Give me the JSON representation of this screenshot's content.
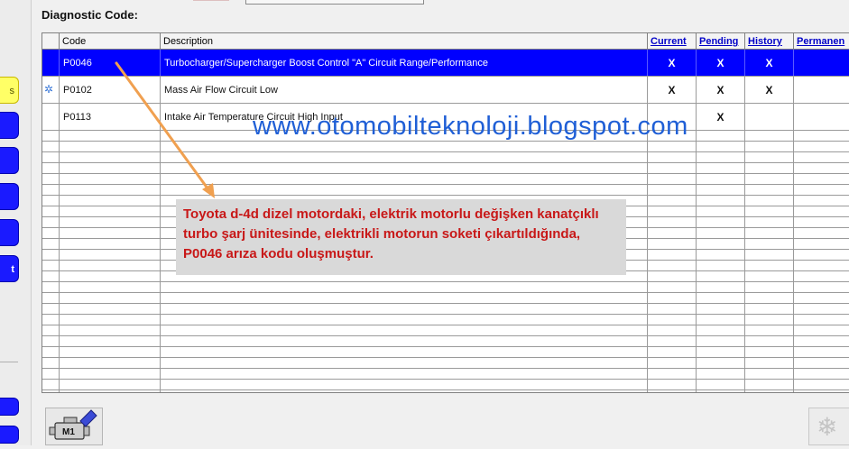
{
  "sidebar": {
    "buttons": [
      {
        "label": "s",
        "style": "yellow"
      },
      {
        "label": ""
      },
      {
        "label": ""
      },
      {
        "label": ""
      },
      {
        "label": ""
      },
      {
        "label": "t"
      },
      {
        "label": ""
      },
      {
        "label": ""
      }
    ]
  },
  "header": {
    "diagnostic_code_label": "Diagnostic Code:"
  },
  "table": {
    "columns": {
      "code": "Code",
      "description": "Description",
      "current": "Current",
      "pending": "Pending",
      "history": "History",
      "permanent": "Permanen"
    },
    "rows": [
      {
        "code": "P0046",
        "description": "Turbocharger/Supercharger Boost Control \"A\" Circuit Range/Performance",
        "current": "X",
        "pending": "X",
        "history": "X",
        "permanent": "",
        "selected": true
      },
      {
        "code": "P0102",
        "description": "Mass Air Flow Circuit Low",
        "current": "X",
        "pending": "X",
        "history": "X",
        "permanent": "",
        "icon": "gear-icon"
      },
      {
        "code": "P0113",
        "description": "Intake Air Temperature Circuit High Input",
        "current": "",
        "pending": "X",
        "history": "",
        "permanent": ""
      }
    ]
  },
  "watermark": "www.otomobilteknoloji.blogspot.com",
  "annotation": {
    "text": "Toyota d-4d dizel motordaki, elektrik motorlu değişken kanatçıklı turbo şarj ünitesinde, elektrikli motorun soketi çıkartıldığında, P0046 arıza kodu oluşmuştur."
  },
  "bottom": {
    "engine_label": "M1"
  },
  "colors": {
    "selection": "#0000ff",
    "link": "#0000c8",
    "nav_button": "#1a1aff",
    "annotation_text": "#c81818",
    "watermark": "#1f5fd6"
  }
}
